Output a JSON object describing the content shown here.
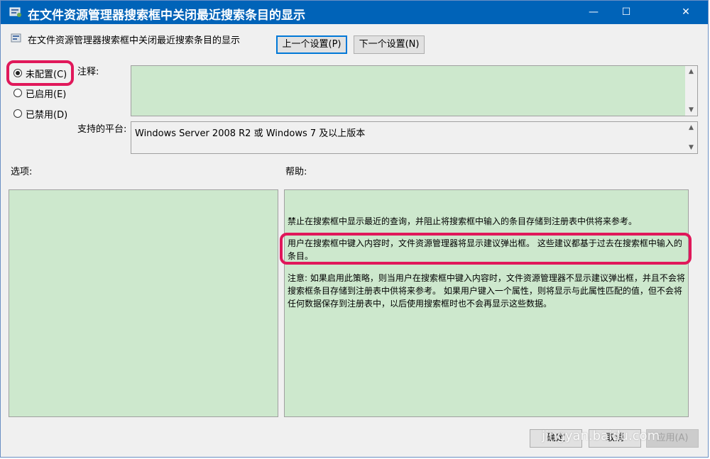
{
  "window": {
    "title": "在文件资源管理器搜索框中关闭最近搜索条目的显示",
    "minimize_glyph": "—",
    "maximize_glyph": "☐",
    "close_glyph": "✕"
  },
  "header": {
    "policy_name": "在文件资源管理器搜索框中关闭最近搜索条目的显示",
    "prev_label": "上一个设置(P)",
    "next_label": "下一个设置(N)"
  },
  "state": {
    "options": [
      {
        "label": "未配置(C)",
        "selected": true
      },
      {
        "label": "已启用(E)",
        "selected": false
      },
      {
        "label": "已禁用(D)",
        "selected": false
      }
    ]
  },
  "comment": {
    "label": "注释:",
    "value": ""
  },
  "platform": {
    "label": "支持的平台:",
    "value": "Windows Server 2008 R2 或 Windows 7 及以上版本"
  },
  "options_section": {
    "label": "选项:"
  },
  "help_section": {
    "label": "帮助:",
    "paragraphs": [
      "禁止在搜索框中显示最近的查询，并阻止将搜索框中输入的条目存储到注册表中供将来参考。",
      "用户在搜索框中键入内容时，文件资源管理器将显示建议弹出框。 这些建议都基于过去在搜索框中输入的条目。",
      "注意: 如果启用此策略，则当用户在搜索框中键入内容时，文件资源管理器不显示建议弹出框，并且不会将搜索框条目存储到注册表中供将来参考。 如果用户键入一个属性，则将显示与此属性匹配的值，但不会将任何数据保存到注册表中，以后使用搜索框时也不会再显示这些数据。"
    ]
  },
  "footer": {
    "ok_label": "确定",
    "cancel_label": "取消",
    "apply_label": "应用(A)"
  },
  "watermark": "jingyan.baidu.com",
  "colors": {
    "titlebar": "#0063b8",
    "highlight": "#e0185a",
    "green": "#cde8cd"
  }
}
